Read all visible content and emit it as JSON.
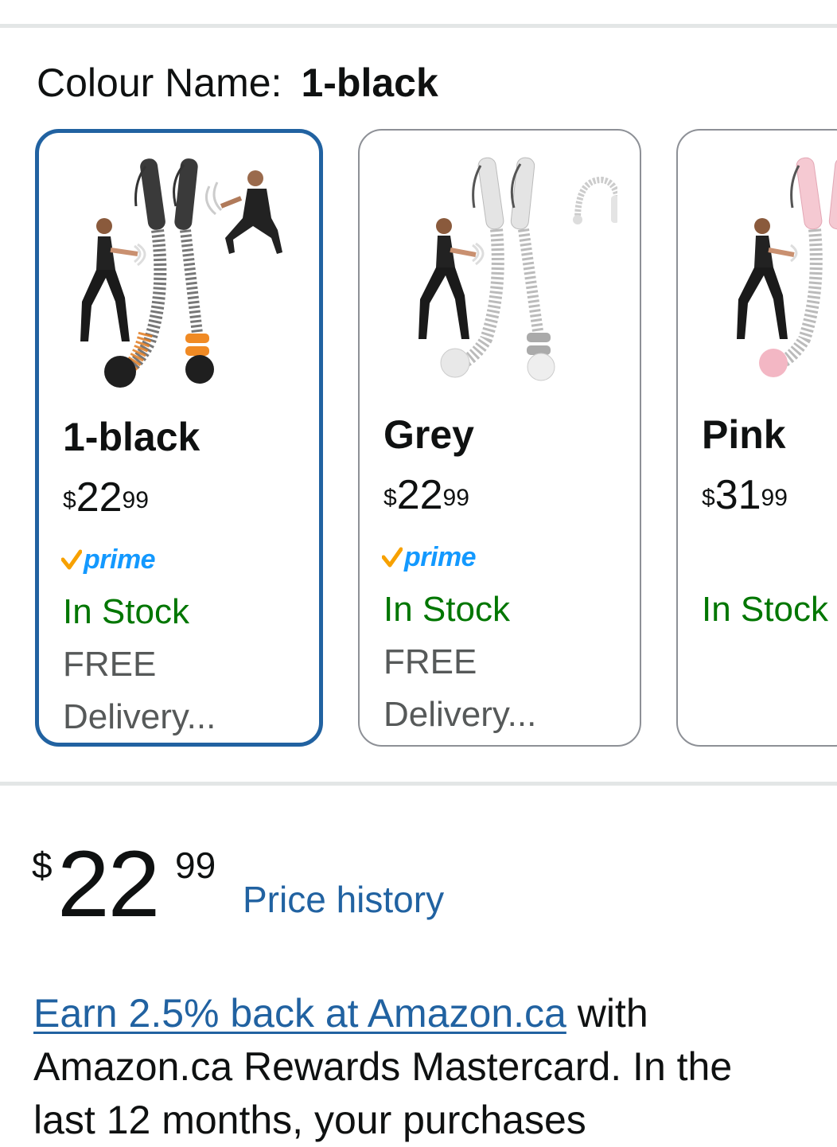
{
  "colour": {
    "label": "Colour Name:",
    "value": "1-black"
  },
  "variants": [
    {
      "name": "1-black",
      "price_symbol": "$",
      "price_whole": "22",
      "price_fraction": "99",
      "prime": "prime",
      "stock": "In Stock",
      "free": "FREE",
      "delivery": "Delivery...",
      "selected": true
    },
    {
      "name": "Grey",
      "price_symbol": "$",
      "price_whole": "22",
      "price_fraction": "99",
      "prime": "prime",
      "stock": "In Stock",
      "free": "FREE",
      "delivery": "Delivery...",
      "selected": false
    },
    {
      "name": "Pink",
      "price_symbol": "$",
      "price_whole": "31",
      "price_fraction": "99",
      "stock": "In Stock",
      "selected": false
    }
  ],
  "price": {
    "symbol": "$",
    "whole": "22",
    "fraction": "99",
    "history_link": "Price history"
  },
  "promo": {
    "link_text": "Earn 2.5% back at Amazon.ca",
    "text": " with Amazon.ca Rewards Mastercard. In the last 12 months, your purchases"
  },
  "colors": {
    "selected_border": "#2162a1",
    "stock_green": "#007600",
    "link_blue": "#2162a1",
    "prime_blue": "#1399ff",
    "prime_orange": "#f7a100"
  }
}
